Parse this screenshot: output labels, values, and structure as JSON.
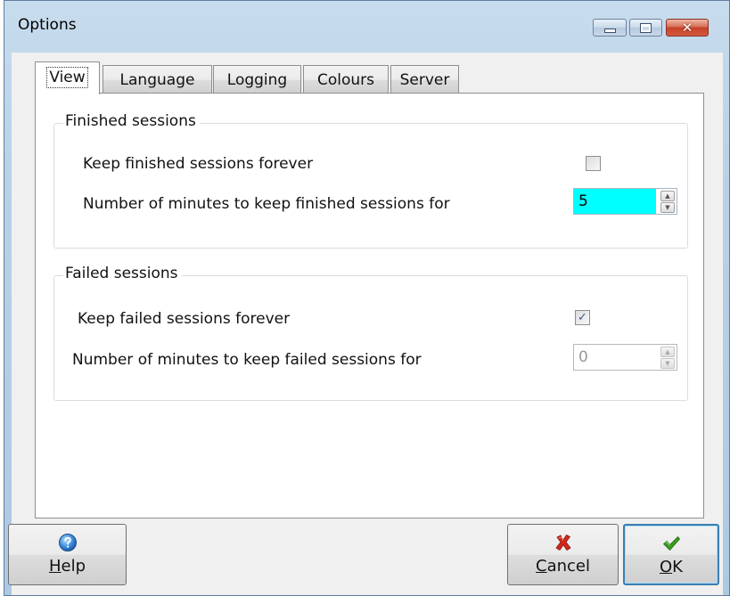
{
  "window": {
    "title": "Options",
    "minimize_icon": "minimize-icon",
    "maximize_icon": "maximize-icon",
    "close_icon": "close-icon",
    "close_glyph": "✕"
  },
  "tabs": [
    {
      "label": "View",
      "active": true
    },
    {
      "label": "Language",
      "active": false
    },
    {
      "label": "Logging",
      "active": false
    },
    {
      "label": "Colours",
      "active": false
    },
    {
      "label": "Server",
      "active": false
    }
  ],
  "finished": {
    "group_title": "Finished sessions",
    "keep_forever_label": "Keep finished sessions forever",
    "keep_forever_checked": false,
    "minutes_label": "Number of minutes to keep finished sessions for",
    "minutes_value": "5",
    "value_highlight": "#00ffff"
  },
  "failed": {
    "group_title": "Failed sessions",
    "keep_forever_label": "Keep failed sessions forever",
    "keep_forever_checked": true,
    "check_glyph": "✓",
    "minutes_label": "Number of minutes to keep failed sessions for",
    "minutes_value": "0",
    "minutes_enabled": false
  },
  "spin_arrows": {
    "up": "▲",
    "down": "▼"
  },
  "buttons": {
    "help": {
      "mnemonic": "H",
      "rest": "elp",
      "icon": "help-icon"
    },
    "cancel": {
      "mnemonic": "C",
      "rest": "ancel",
      "icon": "cancel-icon"
    },
    "ok": {
      "mnemonic": "O",
      "rest": "K",
      "icon": "checkmark-icon"
    }
  },
  "colors": {
    "title_bar": "#b9d1e6",
    "dialog_background": "#f0f0f0",
    "ok_border": "#3c7fb1",
    "cancel_red": "#d0281c",
    "ok_green": "#3a9b1e"
  }
}
